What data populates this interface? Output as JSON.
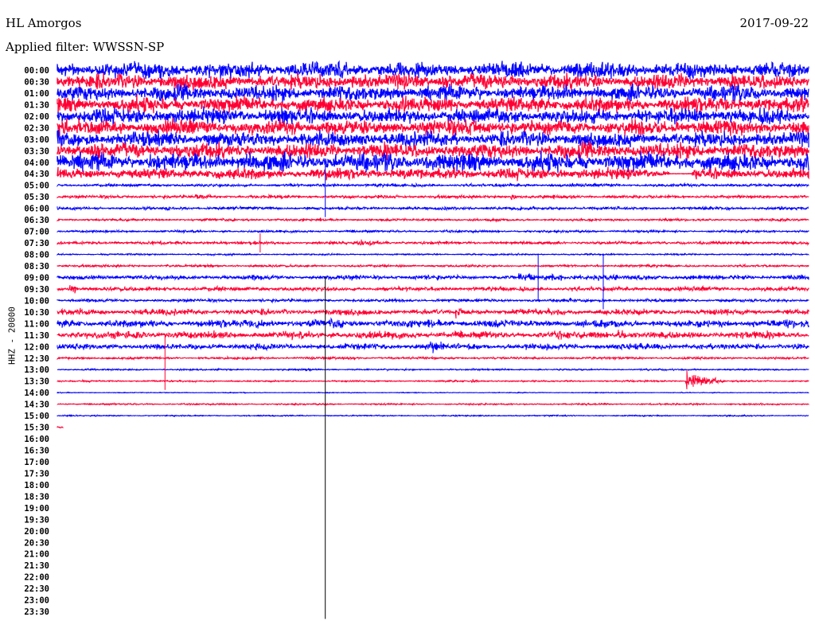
{
  "header": {
    "station": "HL Amorgos",
    "date": "2017-09-22",
    "filter": "Applied filter: WWSSN-SP"
  },
  "chart_data": {
    "type": "line",
    "title": "HL Amorgos",
    "ylabel": "HHZ - 20000",
    "minutes_per_line": 30,
    "colors": [
      "#0000ff",
      "#ff0033"
    ],
    "row_labels": [
      "00:00",
      "00:30",
      "01:00",
      "01:30",
      "02:00",
      "02:30",
      "03:00",
      "03:30",
      "04:00",
      "04:30",
      "05:00",
      "05:30",
      "06:00",
      "06:30",
      "07:00",
      "07:30",
      "08:00",
      "08:30",
      "09:00",
      "09:30",
      "10:00",
      "10:30",
      "11:00",
      "11:30",
      "12:00",
      "12:30",
      "13:00",
      "13:30",
      "14:00",
      "14:30",
      "15:00",
      "15:30",
      "16:00",
      "16:30",
      "17:00",
      "17:30",
      "18:00",
      "18:30",
      "19:00",
      "19:30",
      "20:00",
      "20:30",
      "21:00",
      "21:30",
      "22:00",
      "22:30",
      "23:00",
      "23:30"
    ],
    "noise_amplitude": [
      10,
      10,
      10,
      10,
      10,
      10,
      10,
      10,
      12,
      7,
      2,
      2,
      2,
      1.5,
      1.5,
      2,
      1,
      1.5,
      3,
      3,
      2,
      4,
      5,
      5,
      4,
      1.5,
      1,
      1,
      0.5,
      1,
      0.8,
      1
    ],
    "last_row_end_minute": 0.25,
    "events": [
      {
        "row": 11,
        "minute": 5.6,
        "amp": 6,
        "dur": 1.5
      },
      {
        "row": 11,
        "minute": 18.2,
        "amp": 6,
        "dur": 0.5
      },
      {
        "row": 15,
        "minute": 12.2,
        "amp": 8,
        "dur": 1.2
      },
      {
        "row": 18,
        "minute": 18.5,
        "amp": 7,
        "dur": 11
      },
      {
        "row": 19,
        "minute": 0.6,
        "amp": 8,
        "dur": 0.7
      },
      {
        "row": 21,
        "minute": 16,
        "amp": 8,
        "dur": 1
      },
      {
        "row": 22,
        "minute": 8,
        "amp": 9,
        "dur": 1
      },
      {
        "row": 23,
        "minute": 22.5,
        "amp": 9,
        "dur": 1
      },
      {
        "row": 24,
        "minute": 15,
        "amp": 9,
        "dur": 1.5
      },
      {
        "row": 24,
        "minute": 19.5,
        "amp": 9,
        "dur": 1
      },
      {
        "row": 27,
        "minute": 25.2,
        "amp": 20,
        "dur": 1.2
      },
      {
        "row": 27,
        "minute": 16.6,
        "amp": 4,
        "dur": 0.3
      },
      {
        "row": 31,
        "minute": 7.8,
        "amp": 4,
        "dur": 0.3
      }
    ],
    "spikes": [
      {
        "row": 10,
        "minute": 10.7,
        "amp": 40
      },
      {
        "row": 15,
        "minute": 8.1,
        "amp": 12
      },
      {
        "row": 18,
        "minute": 21.8,
        "amp": 40
      },
      {
        "row": 18,
        "minute": 19.2,
        "amp": 30
      },
      {
        "row": 25,
        "minute": 4.3,
        "amp": 40
      },
      {
        "row": 20,
        "minute": 10.7,
        "amp": 400
      }
    ]
  }
}
